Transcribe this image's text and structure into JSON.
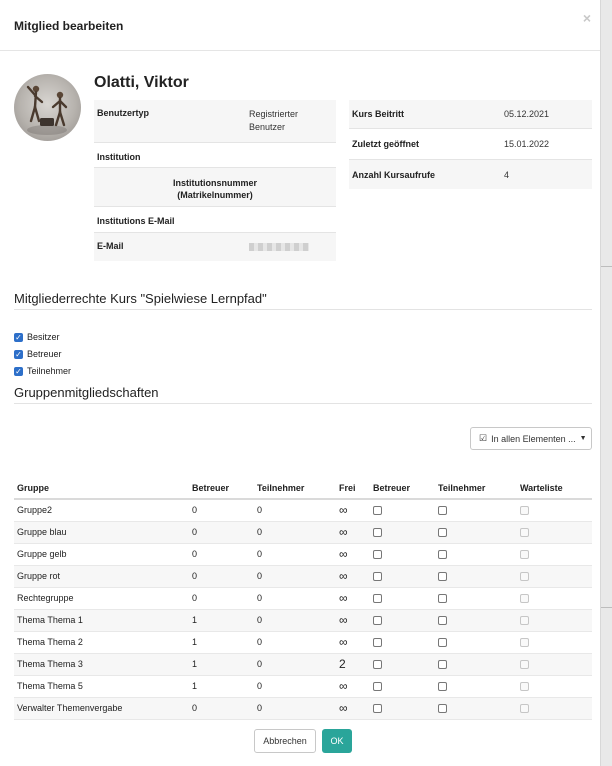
{
  "modal": {
    "title": "Mitglied bearbeiten",
    "close_label": "×"
  },
  "user": {
    "name": "Olatti, Viktor",
    "left_table": [
      {
        "label": "Benutzertyp",
        "value": "Registrierter Benutzer"
      },
      {
        "label": "Institution",
        "value": ""
      },
      {
        "label": "Institutionsnummer (Matrikelnummer)",
        "value": ""
      },
      {
        "label": "Institutions E-Mail",
        "value": ""
      },
      {
        "label": "E-Mail",
        "value": ""
      }
    ],
    "right_table": [
      {
        "label": "Kurs Beitritt",
        "value": "05.12.2021"
      },
      {
        "label": "Zuletzt geöffnet",
        "value": "15.01.2022"
      },
      {
        "label": "Anzahl Kursaufrufe",
        "value": "4"
      }
    ]
  },
  "rights": {
    "title": "Mitgliederrechte Kurs \"Spielwiese Lernpfad\"",
    "options": [
      {
        "label": "Besitzer",
        "checked": true
      },
      {
        "label": "Betreuer",
        "checked": true
      },
      {
        "label": "Teilnehmer",
        "checked": true
      }
    ]
  },
  "groups": {
    "title": "Gruppenmitgliedschaften",
    "filter_label": "In allen Elementen ...",
    "columns": [
      "Gruppe",
      "Betreuer",
      "Teilnehmer",
      "Frei",
      "Betreuer",
      "Teilnehmer",
      "Warteliste"
    ],
    "rows": [
      {
        "name": "Gruppe2",
        "coaches": "0",
        "participants": "0",
        "free": "∞"
      },
      {
        "name": "Gruppe blau",
        "coaches": "0",
        "participants": "0",
        "free": "∞"
      },
      {
        "name": "Gruppe gelb",
        "coaches": "0",
        "participants": "0",
        "free": "∞"
      },
      {
        "name": "Gruppe rot",
        "coaches": "0",
        "participants": "0",
        "free": "∞"
      },
      {
        "name": "Rechtegruppe",
        "coaches": "0",
        "participants": "0",
        "free": "∞"
      },
      {
        "name": "Thema Thema 1",
        "coaches": "1",
        "participants": "0",
        "free": "∞"
      },
      {
        "name": "Thema Thema 2",
        "coaches": "1",
        "participants": "0",
        "free": "∞"
      },
      {
        "name": "Thema Thema 3",
        "coaches": "1",
        "participants": "0",
        "free": "2"
      },
      {
        "name": "Thema Thema 5",
        "coaches": "1",
        "participants": "0",
        "free": "∞"
      },
      {
        "name": "Verwalter Themenvergabe",
        "coaches": "0",
        "participants": "0",
        "free": "∞"
      }
    ]
  },
  "footer": {
    "cancel_label": "Abbrechen",
    "ok_label": "OK"
  },
  "colors": {
    "primary": "#2aa59a",
    "checkbox": "#2d6fc9"
  }
}
